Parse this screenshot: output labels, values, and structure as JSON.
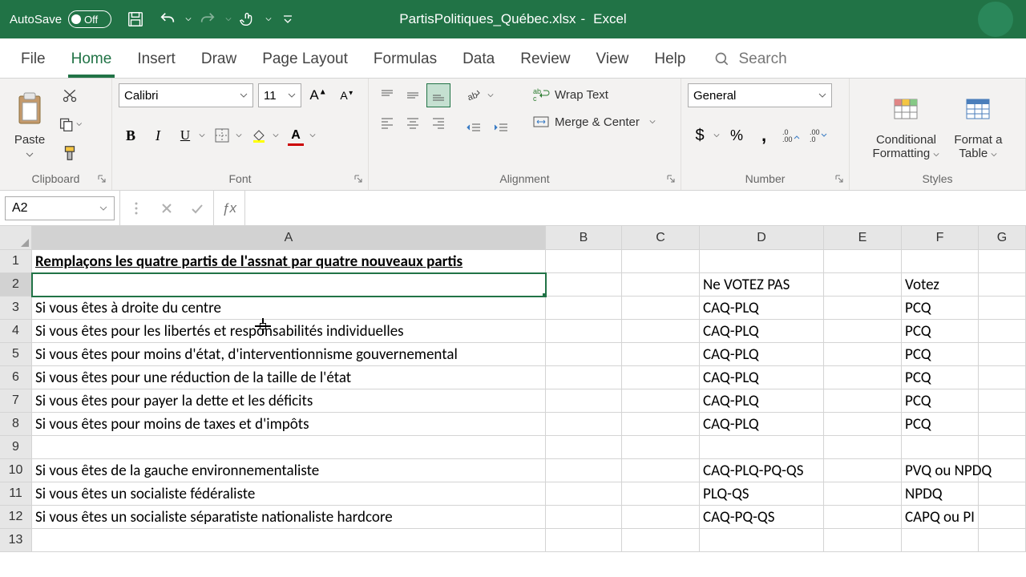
{
  "titlebar": {
    "autosave_label": "AutoSave",
    "autosave_state": "Off",
    "filename": "PartisPolitiques_Québec.xlsx",
    "app": "Excel"
  },
  "tabs": {
    "file": "File",
    "home": "Home",
    "insert": "Insert",
    "draw": "Draw",
    "pagelayout": "Page Layout",
    "formulas": "Formulas",
    "data": "Data",
    "review": "Review",
    "view": "View",
    "help": "Help",
    "search": "Search"
  },
  "ribbon": {
    "clipboard": {
      "paste": "Paste",
      "group": "Clipboard"
    },
    "font": {
      "name": "Calibri",
      "size": "11",
      "group": "Font"
    },
    "alignment": {
      "wrap": "Wrap Text",
      "merge": "Merge & Center",
      "group": "Alignment"
    },
    "number": {
      "format": "General",
      "group": "Number"
    },
    "styles": {
      "conditional_l1": "Conditional",
      "conditional_l2": "Formatting",
      "formatas_l1": "Format a",
      "formatas_l2": "Table",
      "group": "Styles"
    }
  },
  "namebox": "A2",
  "cols": {
    "A": "A",
    "B": "B",
    "C": "C",
    "D": "D",
    "E": "E",
    "F": "F",
    "G": "G"
  },
  "rows": {
    "1": {
      "A": "Remplaçons les quatre partis de l'assnat par quatre nouveaux partis"
    },
    "2": {
      "D": "Ne VOTEZ PAS",
      "F": "Votez"
    },
    "3": {
      "A": "Si vous êtes à droite du centre",
      "D": "CAQ-PLQ",
      "F": "PCQ"
    },
    "4": {
      "A": "Si vous êtes pour les libertés et responsabilités individuelles",
      "D": "CAQ-PLQ",
      "F": "PCQ"
    },
    "5": {
      "A": "Si vous êtes pour moins d'état, d'interventionnisme gouvernemental",
      "D": "CAQ-PLQ",
      "F": "PCQ"
    },
    "6": {
      "A": "Si vous êtes pour une réduction de la taille de l'état",
      "D": "CAQ-PLQ",
      "F": "PCQ"
    },
    "7": {
      "A": "Si vous êtes pour payer la dette et les déficits",
      "D": "CAQ-PLQ",
      "F": "PCQ"
    },
    "8": {
      "A": "Si vous êtes pour moins de taxes et d'impôts",
      "D": "CAQ-PLQ",
      "F": "PCQ"
    },
    "10": {
      "A": "Si vous êtes de la gauche environnementaliste",
      "D": "CAQ-PLQ-PQ-QS",
      "F": "PVQ ou NPDQ"
    },
    "11": {
      "A": "Si vous êtes un socialiste fédéraliste",
      "D": "PLQ-QS",
      "F": "NPDQ"
    },
    "12": {
      "A": "Si vous êtes un socialiste séparatiste nationaliste hardcore",
      "D": "CAQ-PQ-QS",
      "F": "CAPQ ou PI"
    }
  }
}
